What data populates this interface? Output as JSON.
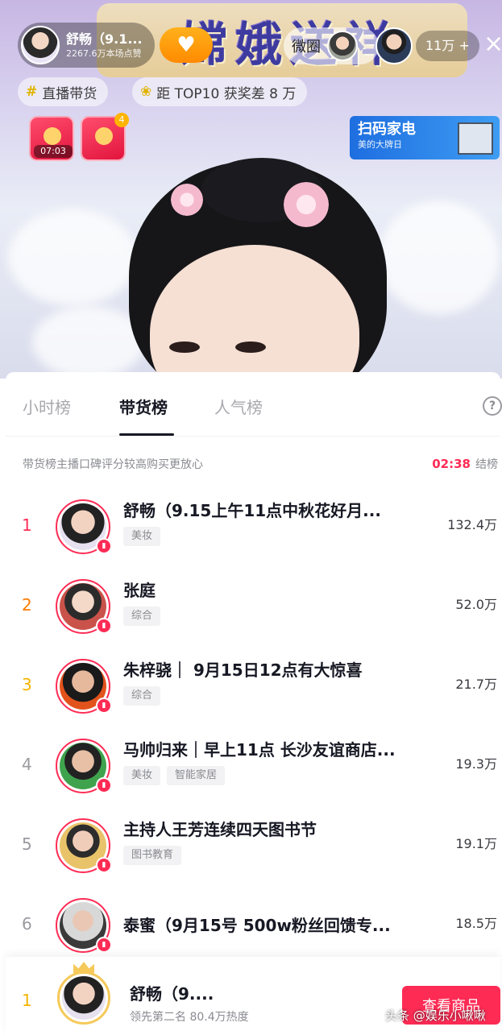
{
  "stream": {
    "banner_text": "嫦娥送祥",
    "host_name": "舒畅（9.1...",
    "host_likes": "2267.6万本场点赞",
    "follow_icon": "heart-plus",
    "weiquan_label": "微圈",
    "viewer_count": "11万 +",
    "close_icon": "close",
    "chip_live_selling": "直播带货",
    "chip_top10": "距 TOP10 获奖差 8 万",
    "red_packet_timer": "07:03",
    "red_packet_badge": "4",
    "ad_title": "扫码家电",
    "ad_subtitle": "美的大牌日"
  },
  "tabs": [
    {
      "label": "小时榜"
    },
    {
      "label": "带货榜"
    },
    {
      "label": "人气榜"
    }
  ],
  "help_label": "?",
  "subheader": {
    "note": "带货榜主播口碑评分较高购买更放心",
    "countdown": "02:38",
    "end_label": "结榜"
  },
  "rankings": [
    {
      "rank": "1",
      "name": "舒畅（9.15上午11点中秋花好月...",
      "tags": [
        "美妆"
      ],
      "value": "132.4万"
    },
    {
      "rank": "2",
      "name": "张庭",
      "tags": [
        "综合"
      ],
      "value": "52.0万"
    },
    {
      "rank": "3",
      "name": "朱梓骁｜ 9月15日12点有大惊喜",
      "tags": [
        "综合"
      ],
      "value": "21.7万"
    },
    {
      "rank": "4",
      "name": "马帅归来｜早上11点 长沙友谊商店...",
      "tags": [
        "美妆",
        "智能家居"
      ],
      "value": "19.3万"
    },
    {
      "rank": "5",
      "name": "主持人王芳连续四天图书节",
      "tags": [
        "图书教育"
      ],
      "value": "19.1万"
    },
    {
      "rank": "6",
      "name": "泰蜜（9月15号 500w粉丝回馈专...",
      "tags": [],
      "value": "18.5万"
    }
  ],
  "bottom": {
    "rank": "1",
    "name": "舒畅（9....",
    "subtitle": "领先第二名 80.4万热度",
    "button_label": "查看商品"
  },
  "watermark": "头条 @娱乐小啾啾",
  "colors": {
    "accent": "#fe2c55",
    "rank2": "#ff7a00",
    "rank3": "#f5b400"
  }
}
